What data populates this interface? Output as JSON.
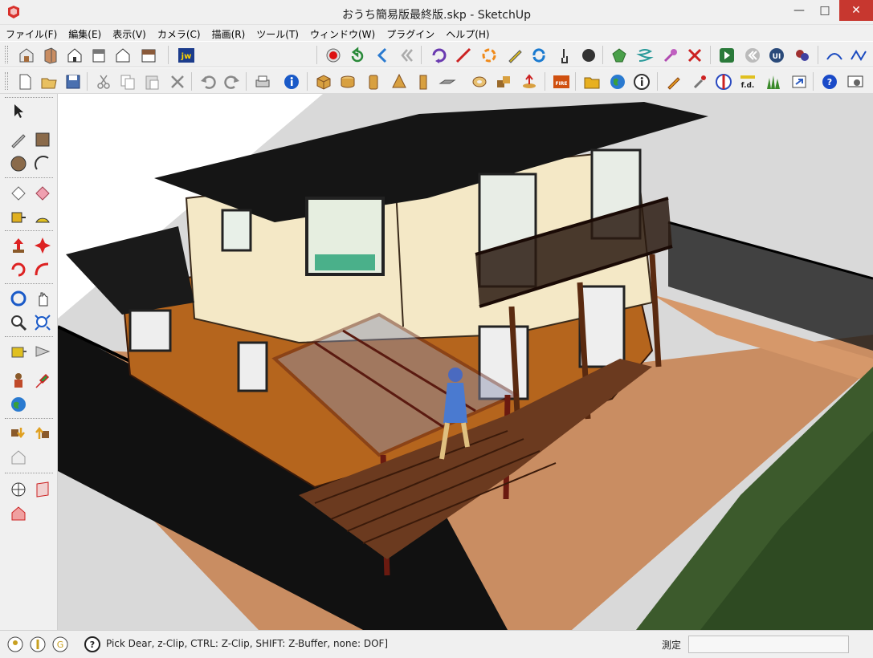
{
  "window": {
    "title": "おうち簡易版最終版.skp - SketchUp",
    "minimize": "—",
    "maximize": "□",
    "close": "✕"
  },
  "menu": [
    "ファイル(F)",
    "編集(E)",
    "表示(V)",
    "カメラ(C)",
    "描画(R)",
    "ツール(T)",
    "ウィンドウ(W)",
    "プラグイン",
    "ヘルプ(H)"
  ],
  "toolbar1": {
    "buttons": [
      "iso-view-icon",
      "top-view-icon",
      "front-view-icon",
      "right-view-icon",
      "back-view-icon",
      "left-view-icon",
      "jw-icon",
      "record-icon",
      "undo-view-icon",
      "prev-icon",
      "rewind-icon",
      "orbit-icon",
      "line-icon",
      "rotate-icon",
      "pencil-icon",
      "refresh-icon",
      "hand-icon",
      "sphere-icon",
      "gem-icon",
      "spring-icon",
      "pin-icon",
      "cross-icon",
      "play-icon",
      "back-icon",
      "ui-icon",
      "plugin-icon",
      "curve-icon",
      "zigzag-icon"
    ],
    "jw_label": "jw",
    "ui_label": "UI"
  },
  "toolbar2": {
    "buttons": [
      "new-file-icon",
      "open-file-icon",
      "save-icon",
      "cut-icon",
      "copy-icon",
      "paste-icon",
      "erase-icon",
      "undo-icon",
      "redo-icon",
      "print-icon",
      "model-info-icon",
      "box-icon",
      "cylinder-icon",
      "column-icon",
      "cone-icon",
      "tube-icon",
      "plate-icon",
      "torus-icon",
      "shapes-icon",
      "push-icon",
      "fire-icon",
      "folder-icon",
      "earth-icon",
      "info-icon",
      "pencil-tool-icon",
      "dropper-icon",
      "section-icon",
      "fd-icon",
      "grass-icon",
      "export-icon",
      "help-icon",
      "settings-icon"
    ],
    "fire_label": "FIRE",
    "fd_label": "f.d."
  },
  "palette": {
    "tools": [
      "select-icon",
      "pencil-line-icon",
      "rectangle-icon",
      "circle-icon",
      "arc-icon",
      "eraser-icon",
      "paint-icon",
      "tape-icon",
      "protractor-icon",
      "push-pull-icon",
      "move-icon",
      "rotate-tool-icon",
      "follow-me-icon",
      "orbit-tool-icon",
      "pan-icon",
      "zoom-icon",
      "zoom-extents-icon",
      "walk-icon",
      "look-icon",
      "warehouse-icon",
      "earth-tool-icon",
      "component-icon",
      "share-icon",
      "house-outline-icon",
      "axes-icon",
      "section-plane-icon",
      "section-display-icon"
    ]
  },
  "status": {
    "icons": [
      "location-icon",
      "credit-icon",
      "google-icon",
      "help-status-icon"
    ],
    "text": "Pick  Dear, z-Clip, CTRL: Z-Clip, SHIFT: Z-Buffer, none: DOF]",
    "measure_label": "測定",
    "measure_value": ""
  },
  "colors": {
    "sky": "#ffffff",
    "ground": "#d8d8d8",
    "yard": "#c98d62",
    "roof": "#1a1a1a",
    "wall_upper": "#f4e8c6",
    "wall_lower": "#b5651d",
    "deck": "#6b3a1f",
    "hedge": "#3c5a2c"
  }
}
